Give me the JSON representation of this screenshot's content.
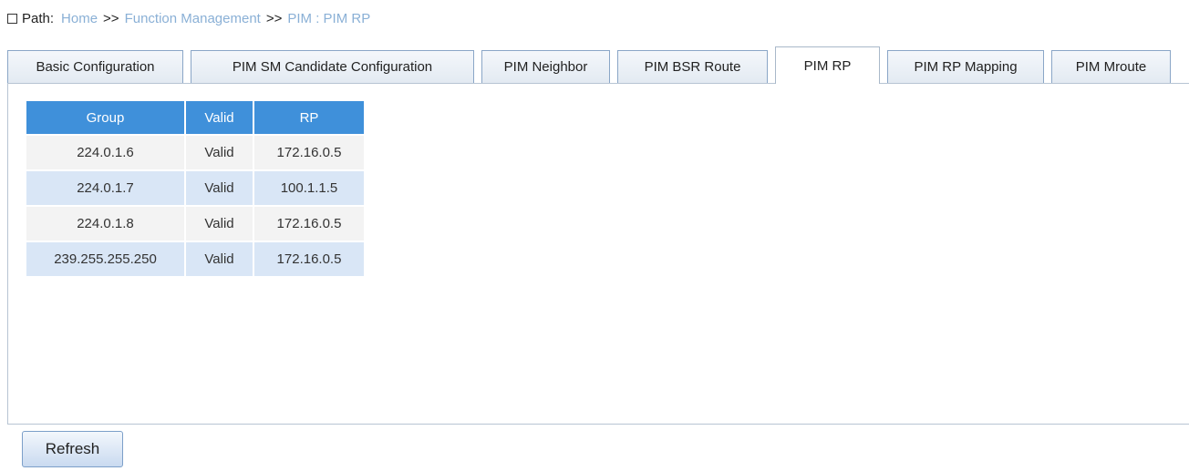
{
  "path": {
    "label": "Path:",
    "crumbs": [
      "Home",
      "Function Management",
      "PIM : PIM RP"
    ],
    "separator": ">>"
  },
  "tabs": [
    {
      "label": "Basic Configuration",
      "active": false
    },
    {
      "label": "PIM SM Candidate Configuration",
      "active": false
    },
    {
      "label": "PIM Neighbor",
      "active": false
    },
    {
      "label": "PIM BSR Route",
      "active": false
    },
    {
      "label": "PIM RP",
      "active": true
    },
    {
      "label": "PIM RP Mapping",
      "active": false
    },
    {
      "label": "PIM Mroute",
      "active": false
    }
  ],
  "table": {
    "headers": [
      "Group",
      "Valid",
      "RP"
    ],
    "rows": [
      [
        "224.0.1.6",
        "Valid",
        "172.16.0.5"
      ],
      [
        "224.0.1.7",
        "Valid",
        "100.1.1.5"
      ],
      [
        "224.0.1.8",
        "Valid",
        "172.16.0.5"
      ],
      [
        "239.255.255.250",
        "Valid",
        "172.16.0.5"
      ]
    ]
  },
  "refresh_label": "Refresh",
  "colors": {
    "header_bg": "#3f90da",
    "row_odd": "#f3f3f3",
    "row_even": "#d9e6f6",
    "link": "#8ab0d6"
  }
}
